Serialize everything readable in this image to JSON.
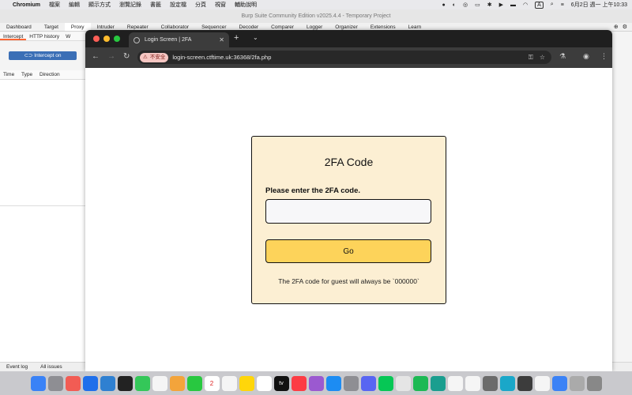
{
  "menubar": {
    "app": "Chromium",
    "items": [
      "檔案",
      "編輯",
      "顯示方式",
      "瀏覽記錄",
      "書籤",
      "設定檔",
      "分頁",
      "視窗",
      "輔助說明"
    ],
    "date_time": "6月2日 週一 上午10:33",
    "input_source": "A"
  },
  "burp": {
    "title": "Burp Suite Community Edition v2025.4.4 - Temporary Project",
    "top_tabs": [
      "Dashboard",
      "Target",
      "Proxy",
      "Intruder",
      "Repeater",
      "Collaborator",
      "Sequencer",
      "Decoder",
      "Comparer",
      "Logger",
      "Organizer",
      "Extensions",
      "Learn"
    ],
    "sub_tabs": [
      "Intercept",
      "HTTP history",
      "W"
    ],
    "intercept_label": "Intercept on",
    "columns": [
      "Time",
      "Type",
      "Direction"
    ],
    "bottom_tabs": [
      "Event log",
      "All issues"
    ]
  },
  "chrome": {
    "tab_title": "Login Screen | 2FA",
    "security_label": "不安全",
    "url": "login-screen.ctftime.uk:36368/2fa.php"
  },
  "page": {
    "heading": "2FA Code",
    "input_label": "Please enter the 2FA code.",
    "input_value": "",
    "button_label": "Go",
    "note": "The 2FA code for guest will always be `000000`"
  },
  "dock": {
    "calendar_day": "2",
    "tv_label": "tv"
  },
  "colors": {
    "card_background": "#fcefd3",
    "button_background": "#fdd35a",
    "intercept_button": "#3b6fb6"
  }
}
